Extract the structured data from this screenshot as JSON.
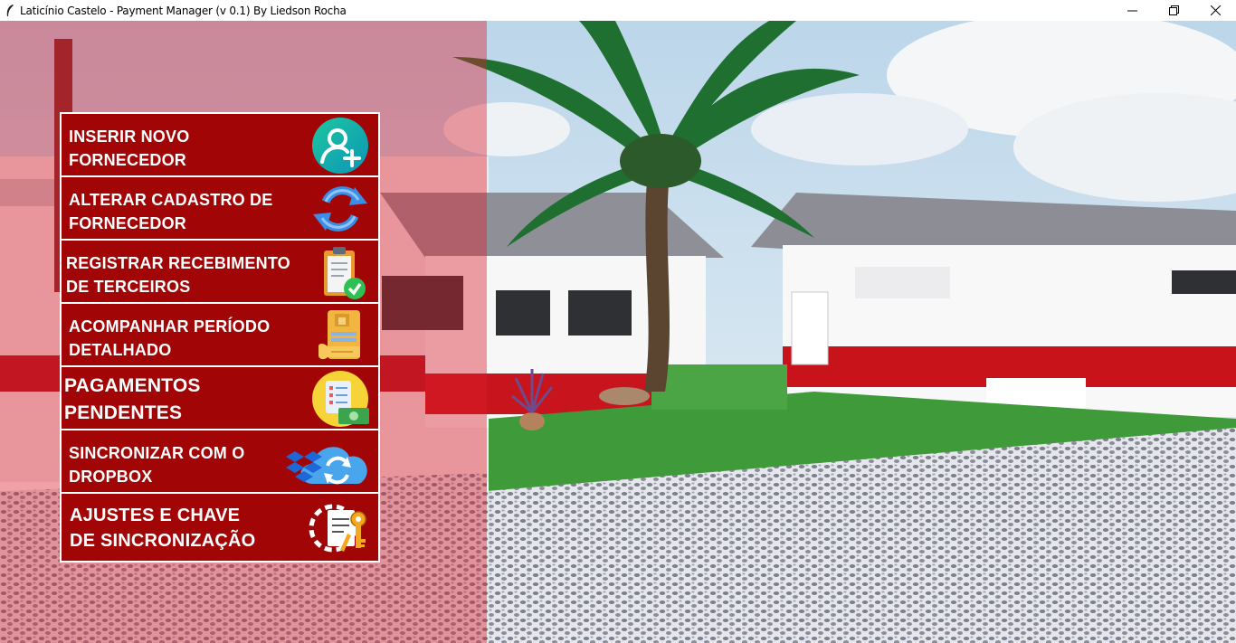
{
  "window": {
    "title": "Laticínio Castelo - Payment Manager (v 0.1) By Liedson Rocha",
    "controls": [
      "minimize",
      "maximize",
      "close"
    ]
  },
  "menu": {
    "items": [
      {
        "label": "INSERIR NOVO\nFORNECEDOR",
        "icon": "add-user-icon"
      },
      {
        "label": "ALTERAR CADASTRO DE\nFORNECEDOR",
        "icon": "refresh-icon"
      },
      {
        "label": "REGISTRAR RECEBIMENTO\nDE TERCEIROS",
        "icon": "clipboard-check-icon"
      },
      {
        "label": "ACOMPANHAR PERÍODO\nDETALHADO",
        "icon": "receipt-scroll-icon"
      },
      {
        "label": "PAGAMENTOS\nPENDENTES",
        "icon": "invoice-money-icon"
      },
      {
        "label": "SINCRONIZAR COM O\nDROPBOX",
        "icon": "dropbox-cloud-sync-icon"
      },
      {
        "label": "AJUSTES E CHAVE\nDE SINCRONIZAÇÃO",
        "icon": "settings-key-icon"
      }
    ]
  },
  "colors": {
    "menu_bg": "#a10505",
    "overlay": "#dc1e2d",
    "accent_teal": "#12b3a5"
  }
}
